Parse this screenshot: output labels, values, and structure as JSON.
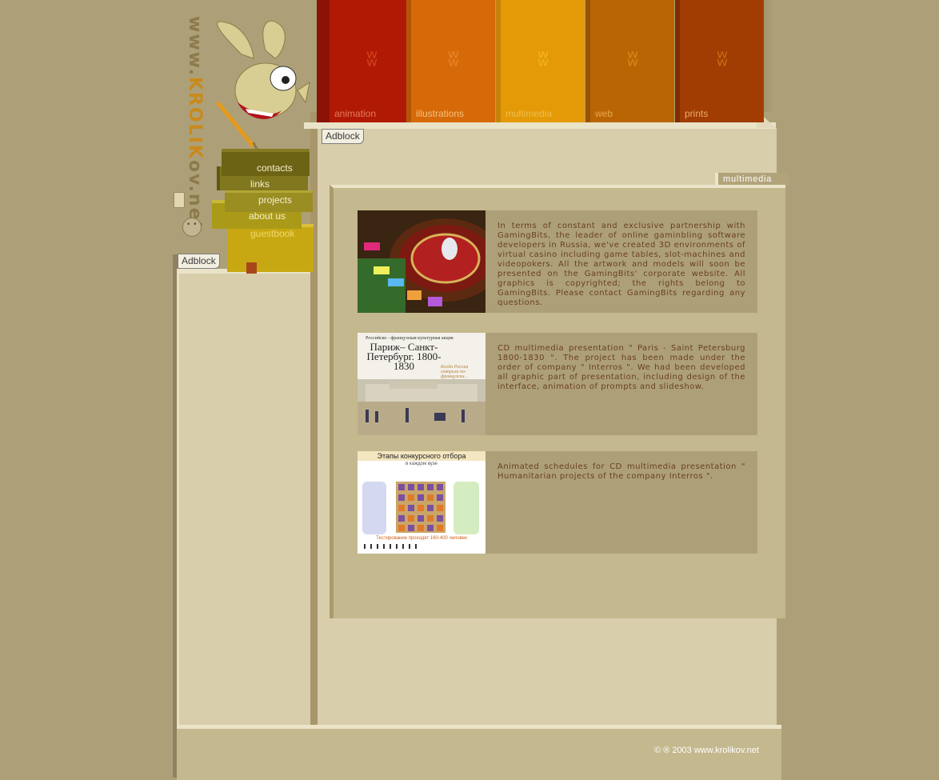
{
  "logo": {
    "prefix": "www.",
    "brand": "KROLIK",
    "suffix": "ov.net"
  },
  "menu": {
    "contacts": "contacts",
    "links": "links",
    "projects": "projects",
    "about": "about us",
    "guestbook": "guestbook"
  },
  "adblock": {
    "left": "Adblock",
    "top": "Adblock"
  },
  "tabs": [
    {
      "label": "animation",
      "color": "#b01a05"
    },
    {
      "label": "illustrations",
      "color": "#d76a08"
    },
    {
      "label": "multimedia",
      "color": "#e39a06"
    },
    {
      "label": "web",
      "color": "#ba6504"
    },
    {
      "label": "prints",
      "color": "#a13d03"
    }
  ],
  "section_title": "multimedia",
  "items": [
    {
      "thumb": "roulette-casino-image",
      "text": "In terms of constant and exclusive partnership with GamingBits, the leader of online gaminbling software developers in Russia, we've created 3D environments of virtual casino including game tables, slot-machines and videopokers. All the artwork and models will soon be presented on the GamingBits' corporate website. All graphics is copyrighted; the rights belong to GamingBits. Please contact GamingBits regarding any questions."
    },
    {
      "thumb": "paris-petersburg-cover-image",
      "thumb_caption_small": "Российско - французская культурная акция",
      "thumb_title": "Париж– Санкт-Петербург. 1800-1830",
      "thumb_aside": "Когда Россия говорила по-французски...",
      "text": "CD multimedia presentation \" Paris - Saint Petersburg 1800-1830 \".  The project has been made under the order of company \" Interros \". We had been developed all graphic part of presentation, including design of the interface, animation of prompts and slideshow."
    },
    {
      "thumb": "schedule-diagram-image",
      "thumb_title": "Этапы конкурсного отбора",
      "thumb_subtitle": "в каждом вузе",
      "thumb_footer": "Тестирование проходят 160-400 человек",
      "text": "Animated schedules for CD multimedia presentation \" Humanitarian projects of the company Interros \"."
    }
  ],
  "footer": {
    "copyright": "© ® 2003 www.krolikov.net"
  }
}
